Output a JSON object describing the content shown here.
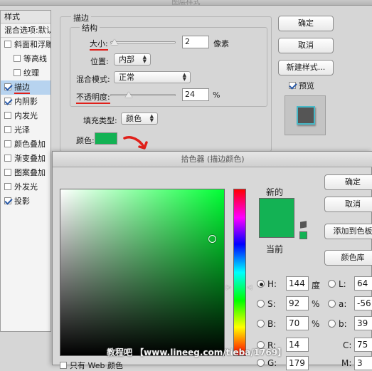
{
  "dialog": {
    "title": "图层样式"
  },
  "sidebar": {
    "header": "样式",
    "blend_options": "混合选项:默认",
    "items": [
      {
        "label": "斜面和浮雕",
        "checked": false,
        "sub": false
      },
      {
        "label": "等高线",
        "checked": false,
        "sub": true
      },
      {
        "label": "纹理",
        "checked": false,
        "sub": true
      },
      {
        "label": "描边",
        "checked": true,
        "sub": false,
        "selected": true
      },
      {
        "label": "内阴影",
        "checked": true,
        "sub": false
      },
      {
        "label": "内发光",
        "checked": false,
        "sub": false
      },
      {
        "label": "光泽",
        "checked": false,
        "sub": false
      },
      {
        "label": "颜色叠加",
        "checked": false,
        "sub": false
      },
      {
        "label": "渐变叠加",
        "checked": false,
        "sub": false
      },
      {
        "label": "图案叠加",
        "checked": false,
        "sub": false
      },
      {
        "label": "外发光",
        "checked": false,
        "sub": false
      },
      {
        "label": "投影",
        "checked": true,
        "sub": false
      }
    ]
  },
  "stroke": {
    "section_title": "描边",
    "structure_title": "结构",
    "size_label": "大小:",
    "size_value": "2",
    "size_unit": "像素",
    "position_label": "位置:",
    "position_value": "内部",
    "blend_mode_label": "混合模式:",
    "blend_mode_value": "正常",
    "opacity_label": "不透明度:",
    "opacity_value": "24",
    "opacity_unit": "%",
    "fill_type_label": "填充类型:",
    "fill_type_value": "颜色",
    "color_label": "颜色:",
    "color_hex": "#13b254"
  },
  "main_buttons": {
    "ok": "确定",
    "cancel": "取消",
    "new_style": "新建样式...",
    "preview_label": "预览",
    "preview_checked": true
  },
  "picker": {
    "title": "拾色器 (描边颜色)",
    "new_label": "新的",
    "current_label": "当前",
    "new_color": "#13b254",
    "current_color": "#13b254",
    "buttons": {
      "ok": "确定",
      "cancel": "取消",
      "add_swatch": "添加到色板",
      "libraries": "颜色库"
    },
    "fields": {
      "H": {
        "label": "H:",
        "value": "144",
        "unit": "度"
      },
      "S": {
        "label": "S:",
        "value": "92",
        "unit": "%"
      },
      "B": {
        "label": "B:",
        "value": "70",
        "unit": "%"
      },
      "R": {
        "label": "R:",
        "value": "14"
      },
      "G": {
        "label": "G:",
        "value": "179"
      },
      "L": {
        "label": "L:",
        "value": "64"
      },
      "a": {
        "label": "a:",
        "value": "-56"
      },
      "b": {
        "label": "b:",
        "value": "39"
      },
      "C": {
        "label": "C:",
        "value": "75"
      },
      "M": {
        "label": "M:",
        "value": "3"
      }
    },
    "web_only_label": "只有 Web 颜色"
  },
  "watermark": "教程吧 【www.lineeg.com/tieba/1769】"
}
